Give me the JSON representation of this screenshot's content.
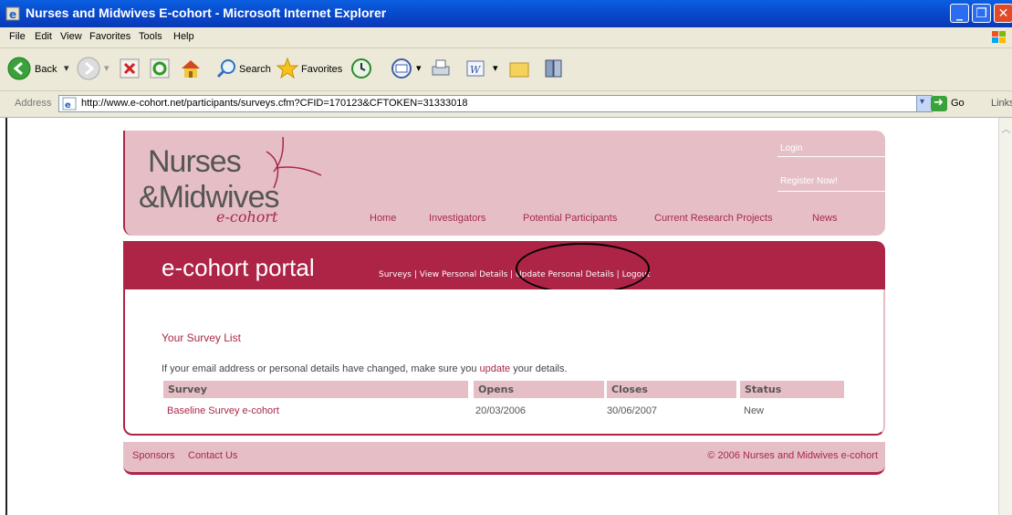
{
  "window": {
    "title": "Nurses and Midwives E-cohort - Microsoft Internet Explorer",
    "min_glyph": "_",
    "max_glyph": "❐",
    "close_glyph": "✕"
  },
  "menu": [
    "File",
    "Edit",
    "View",
    "Favorites",
    "Tools",
    "Help"
  ],
  "toolbar": {
    "back": "Back",
    "search": "Search",
    "favorites": "Favorites"
  },
  "address": {
    "label": "Address",
    "url": "http://www.e-cohort.net/participants/surveys.cfm?CFID=170123&CFTOKEN=31333018",
    "go": "Go",
    "links": "Links"
  },
  "site": {
    "logo": {
      "line1": "Nurses",
      "line2": "&Midwives",
      "sub": "e-cohort"
    },
    "side_links": {
      "login": "Login",
      "register": "Register Now!"
    },
    "nav": [
      "Home",
      "Investigators",
      "Potential Participants",
      "Current Research Projects",
      "News"
    ],
    "portal_title": "e-cohort portal",
    "portal_nav": "Surveys | View Personal Details | Update Personal Details | Logout",
    "survey_heading": "Your Survey List",
    "notice_before": "If your email address or personal details have changed, make sure you ",
    "notice_link": "update",
    "notice_after": " your details.",
    "table": {
      "headers": [
        "Survey",
        "Opens",
        "Closes",
        "Status"
      ],
      "rows": [
        {
          "survey": "Baseline Survey e-cohort",
          "opens": "20/03/2006",
          "closes": "30/06/2007",
          "status": "New"
        }
      ]
    },
    "footer": {
      "sponsors": "Sponsors",
      "contact": "Contact Us",
      "copyright": "© 2006 Nurses and Midwives e-cohort"
    }
  },
  "colors": {
    "brand": "#ad2447",
    "brand_light": "#e6bfc6",
    "titlebar": "#0845c8"
  }
}
